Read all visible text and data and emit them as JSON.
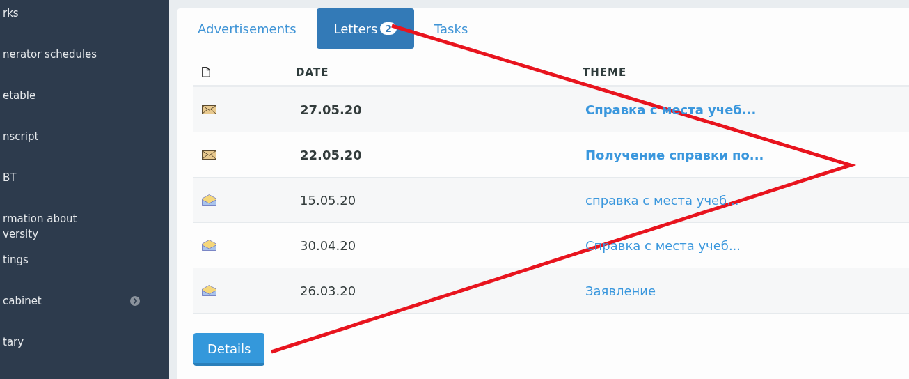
{
  "sidebar": {
    "items": [
      {
        "label": "rks",
        "expandable": false
      },
      {
        "label": "nerator schedules",
        "expandable": false
      },
      {
        "label": "etable",
        "expandable": false
      },
      {
        "label": "nscript",
        "expandable": false
      },
      {
        "label": "BT",
        "expandable": false
      },
      {
        "label": "rmation about\nversity",
        "expandable": false
      },
      {
        "label": "tings",
        "expandable": false
      },
      {
        "label": "cabinet",
        "expandable": true
      },
      {
        "label": "tary",
        "expandable": false
      }
    ]
  },
  "tabs": [
    {
      "label": "Advertisements",
      "selected": false
    },
    {
      "label": "Letters",
      "badge": "2",
      "selected": true
    },
    {
      "label": "Tasks",
      "selected": false
    }
  ],
  "table": {
    "columns": [
      "DATE",
      "THEME"
    ],
    "rows": [
      {
        "date": "27.05.20",
        "theme": "Справка с места учеб...",
        "unread": true
      },
      {
        "date": "22.05.20",
        "theme": "Получение справки по...",
        "unread": true
      },
      {
        "date": "15.05.20",
        "theme": "справка с места учеб...",
        "unread": false
      },
      {
        "date": "30.04.20",
        "theme": "Справка с места учеб...",
        "unread": false
      },
      {
        "date": "26.03.20",
        "theme": "Заявление",
        "unread": false
      }
    ]
  },
  "details_button": "Details"
}
